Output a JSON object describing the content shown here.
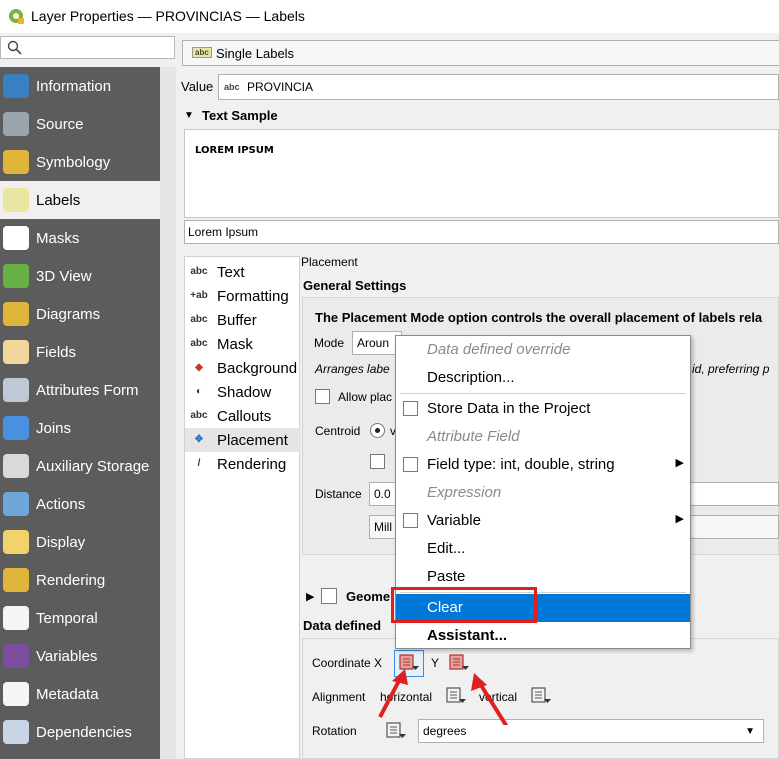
{
  "window": {
    "title": "Layer Properties — PROVINCIAS — Labels"
  },
  "search": {
    "placeholder": ""
  },
  "sidebar": {
    "items": [
      {
        "label": "Information",
        "icon": "info-icon",
        "color": "#3a7fc1"
      },
      {
        "label": "Source",
        "icon": "tools-icon",
        "color": "#9aa4ad"
      },
      {
        "label": "Symbology",
        "icon": "paintbrush-icon",
        "color": "#e0b53c"
      },
      {
        "label": "Labels",
        "icon": "labels-icon",
        "color": "#e8e6a0",
        "selected": true
      },
      {
        "label": "Masks",
        "icon": "mask-icon",
        "color": "#ffffff"
      },
      {
        "label": "3D View",
        "icon": "cube-icon",
        "color": "#66b044"
      },
      {
        "label": "Diagrams",
        "icon": "diagram-icon",
        "color": "#e0b53c"
      },
      {
        "label": "Fields",
        "icon": "fields-icon",
        "color": "#f0d89a"
      },
      {
        "label": "Attributes Form",
        "icon": "form-icon",
        "color": "#bfc9d6"
      },
      {
        "label": "Joins",
        "icon": "join-icon",
        "color": "#4a90e2"
      },
      {
        "label": "Auxiliary Storage",
        "icon": "database-icon",
        "color": "#d9d9d9"
      },
      {
        "label": "Actions",
        "icon": "gear-icon",
        "color": "#6fa6d8"
      },
      {
        "label": "Display",
        "icon": "speech-bubble-icon",
        "color": "#f2d36b"
      },
      {
        "label": "Rendering",
        "icon": "paintbrush-icon",
        "color": "#e0b53c"
      },
      {
        "label": "Temporal",
        "icon": "clock-icon",
        "color": "#f5f5f5"
      },
      {
        "label": "Variables",
        "icon": "epsilon-icon",
        "color": "#7b4f9d"
      },
      {
        "label": "Metadata",
        "icon": "pencil-doc-icon",
        "color": "#f5f5f5"
      },
      {
        "label": "Dependencies",
        "icon": "dependencies-icon",
        "color": "#c8d6e5"
      }
    ]
  },
  "labels": {
    "mode": "Single Labels",
    "value_label": "Value",
    "value_field": "PROVINCIA",
    "text_sample": "Text Sample",
    "preview": "LOREM IPSUM",
    "sample_input": "Lorem Ipsum"
  },
  "tabs": [
    {
      "label": "Text",
      "icon": "abc"
    },
    {
      "label": "Formatting",
      "icon": "+ab"
    },
    {
      "label": "Buffer",
      "icon": "abc"
    },
    {
      "label": "Mask",
      "icon": "abc"
    },
    {
      "label": "Background",
      "icon": "shield"
    },
    {
      "label": "Shadow",
      "icon": "shadow"
    },
    {
      "label": "Callouts",
      "icon": "abc"
    },
    {
      "label": "Placement",
      "icon": "arrows",
      "selected": true
    },
    {
      "label": "Rendering",
      "icon": "brush"
    }
  ],
  "placement": {
    "header": "Placement",
    "general": "General Settings",
    "description": "The Placement Mode option controls the overall placement of labels rela",
    "mode_label": "Mode",
    "mode_value": "Aroun",
    "arranges": "Arranges labe",
    "arranges_tail": "id, preferring p",
    "allow": "Allow plac",
    "centroid_label": "Centroid",
    "centroid_value": "v",
    "distance_label": "Distance",
    "distance_value": "0.0",
    "unit_value": "Mill",
    "geometry": "Geome",
    "data_defined": "Data defined",
    "coord_label": "Coordinate X",
    "coord_y": "Y",
    "alignment_label": "Alignment",
    "horizontal": "horizontal",
    "vertical": "vertical",
    "rotation_label": "Rotation",
    "rotation_value": "degrees"
  },
  "menu": {
    "items": [
      {
        "label": "Data defined override",
        "disabled": true
      },
      {
        "label": "Description..."
      },
      {
        "label": "Store Data in the Project",
        "check": true
      },
      {
        "label": "Attribute Field",
        "disabled": true
      },
      {
        "label": "Field type: int, double, string",
        "check": true,
        "submenu": true
      },
      {
        "label": "Expression",
        "disabled": true
      },
      {
        "label": "Variable",
        "check": true,
        "submenu": true
      },
      {
        "label": "Edit..."
      },
      {
        "label": "Paste"
      },
      {
        "label": "Clear",
        "highlight": true
      },
      {
        "label": "Assistant...",
        "bold": true
      }
    ]
  },
  "colors": {
    "accent": "#0078d7",
    "annotation": "#e02020",
    "sidebar_bg": "#5c5c5c"
  }
}
